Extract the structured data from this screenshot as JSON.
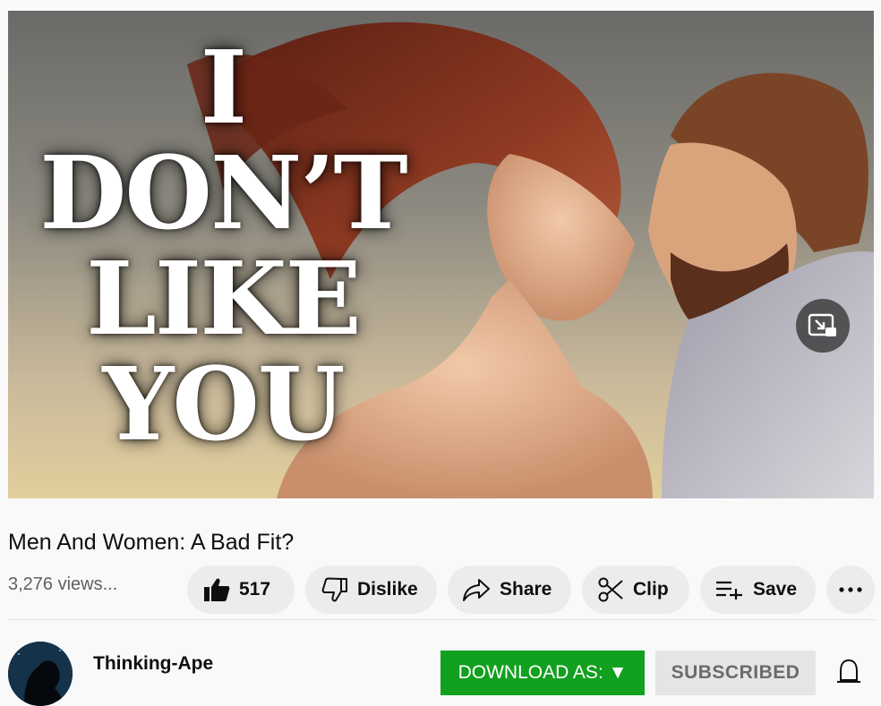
{
  "thumbnail": {
    "text_lines": [
      "I",
      "DON’T",
      "LIKE",
      "YOU"
    ],
    "miniplayer_icon": "miniplayer-icon"
  },
  "video": {
    "title": "Men And Women: A Bad Fit?",
    "views": "3,276 views..."
  },
  "actions": {
    "like_count": "517",
    "dislike_label": "Dislike",
    "share_label": "Share",
    "clip_label": "Clip",
    "save_label": "Save",
    "icons": [
      "thumbs-up-icon",
      "thumbs-down-icon",
      "share-arrow-icon",
      "scissors-icon",
      "playlist-add-icon",
      "more-horizontal-icon"
    ]
  },
  "channel": {
    "name": "Thinking-Ape",
    "download_label": "DOWNLOAD AS: ▼",
    "subscribed_label": "SUBSCRIBED",
    "bell_icon": "bell-icon"
  },
  "colors": {
    "download_green": "#12a01f",
    "pill_bg": "#ececec",
    "page_bg": "#f9f9f9"
  }
}
